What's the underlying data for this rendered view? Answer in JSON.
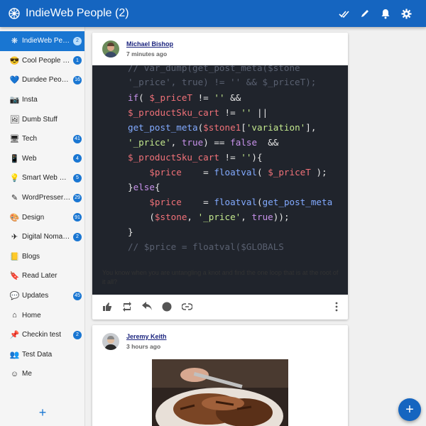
{
  "appbar": {
    "title": "IndieWeb People (2)",
    "logo_icon": "indieweb-logo-icon",
    "actions": [
      "mark-all-read-icon",
      "edit-icon",
      "bell-icon",
      "gear-icon"
    ]
  },
  "sidebar": {
    "items": [
      {
        "label": "IndieWeb People",
        "count": "2",
        "icon": "indieweb-icon",
        "active": true
      },
      {
        "label": "Cool People (🐘)",
        "count": "1",
        "icon": "sunglasses-emoji-icon"
      },
      {
        "label": "Dundee People ...",
        "count": "16",
        "icon": "blue-heart-icon"
      },
      {
        "label": "Insta",
        "count": "",
        "icon": "camera-icon"
      },
      {
        "label": "Dumb Stuff",
        "count": "",
        "icon": "picture-icon"
      },
      {
        "label": "Tech",
        "count": "41",
        "icon": "laptop-icon"
      },
      {
        "label": "Web",
        "count": "4",
        "icon": "phone-icon"
      },
      {
        "label": "Smart Web Peop...",
        "count": "5",
        "icon": "lightbulb-icon"
      },
      {
        "label": "WordPressers (...",
        "count": "29",
        "icon": "pencil-icon"
      },
      {
        "label": "Design",
        "count": "91",
        "icon": "palette-icon"
      },
      {
        "label": "Digital Nomads...",
        "count": "2",
        "icon": "airplane-icon"
      },
      {
        "label": "Blogs",
        "count": "",
        "icon": "notebook-icon"
      },
      {
        "label": "Read Later",
        "count": "",
        "icon": "bookmark-icon"
      },
      {
        "label": "Updates",
        "count": "45",
        "icon": "speech-bubble-icon"
      },
      {
        "label": "Home",
        "count": "",
        "icon": "home-icon"
      },
      {
        "label": "Checkin test",
        "count": "2",
        "icon": "pushpin-icon"
      },
      {
        "label": "Test Data",
        "count": "",
        "icon": "people-icon"
      },
      {
        "label": "Me",
        "count": "",
        "icon": "face-icon"
      }
    ],
    "add_label": "+"
  },
  "posts": [
    {
      "author": "Michael Bishop",
      "time": "7 minutes ago",
      "code_lines": [
        "// var_dump(get_post_meta($stone",
        "'_price', true) != '' && $_priceT);",
        "if( $_priceT != '' &&",
        "$_productSku_cart != '' ||",
        "get_post_meta($stone1['variation'],",
        "'_price', true) == false  &&",
        "$_productSku_cart != ''){",
        "    $price    = floatval( $_priceT );",
        "}else{",
        "    $price    = floatval(get_post_meta",
        "    ($stone, '_price', true));",
        "}",
        "// $price = floatval($GLOBALS"
      ],
      "caption": "You know when you are untangling a knot and find the one loop that is at the root of it all?",
      "actions": [
        "like-icon",
        "repost-icon",
        "reply-icon",
        "read-status-icon",
        "link-icon",
        "more-icon"
      ]
    },
    {
      "author": "Jeremy Keith",
      "time": "3 hours ago"
    }
  ],
  "fab": {
    "label": "+"
  },
  "colors": {
    "primary": "#1565c0",
    "active": "#1976d2",
    "code_bg": "#20242c"
  }
}
